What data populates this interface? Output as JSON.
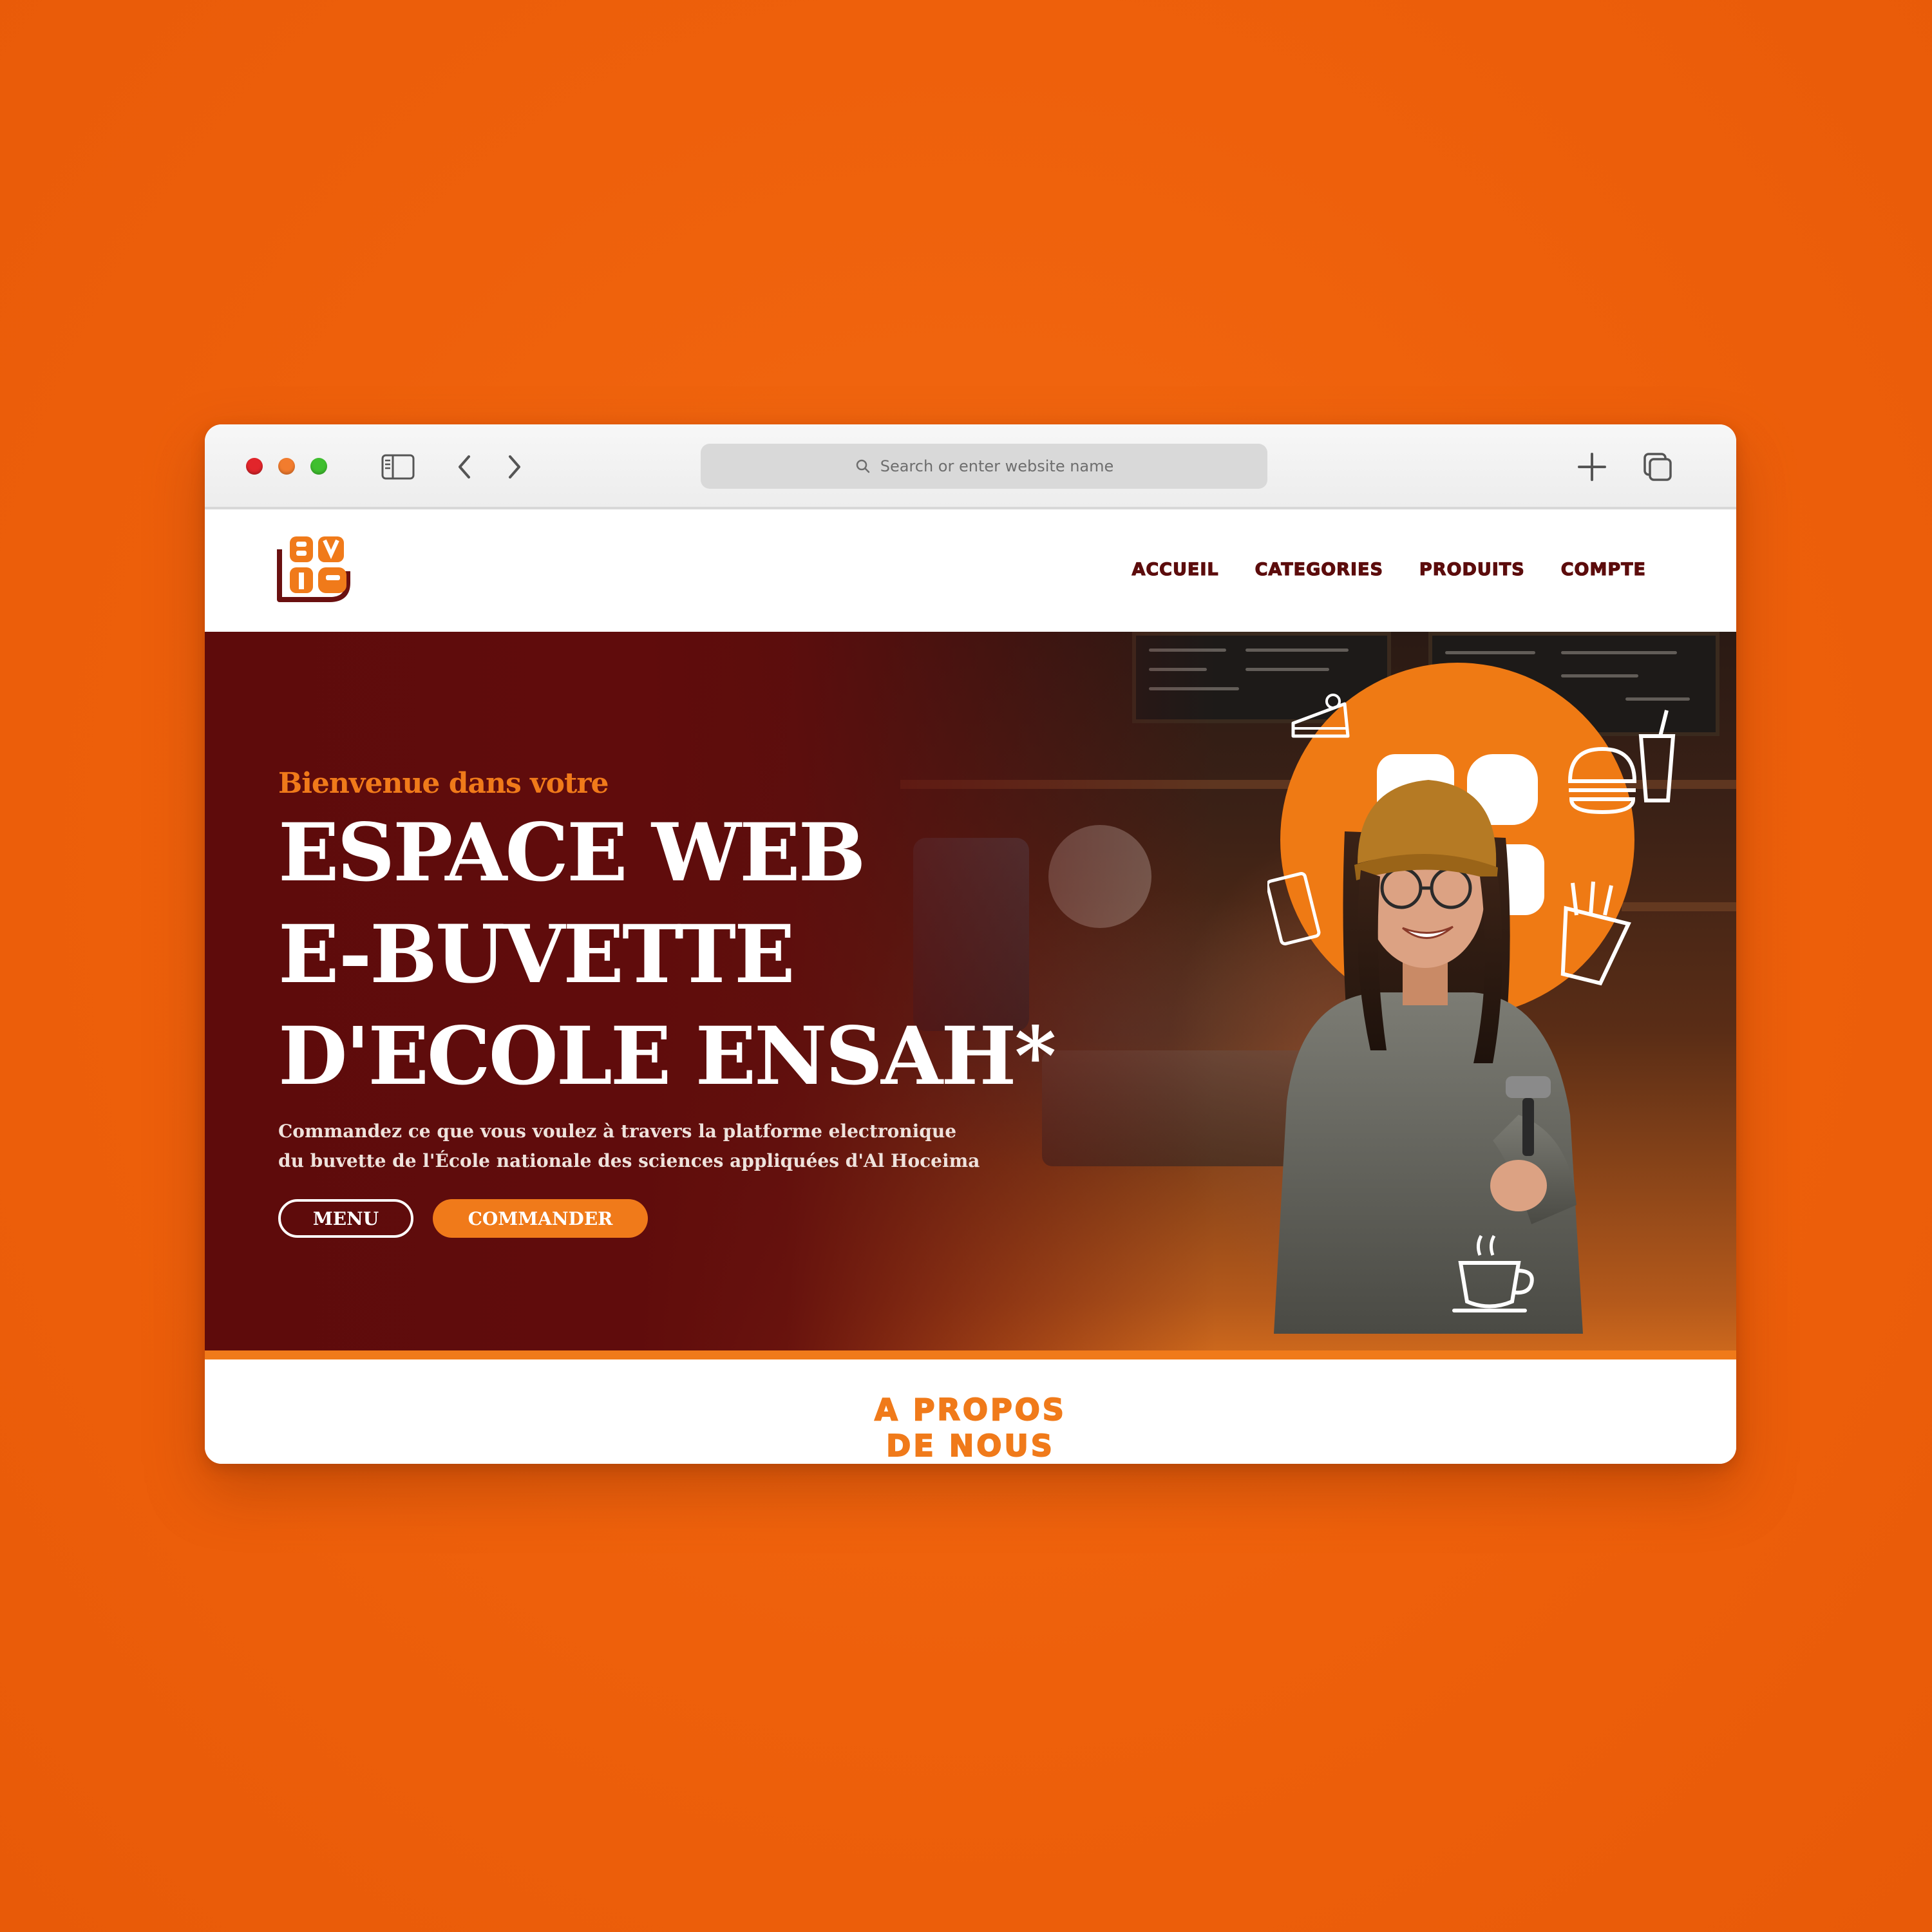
{
  "browser": {
    "address_placeholder": "Search or enter website name",
    "icons": [
      "sidebar-icon",
      "back-icon",
      "forward-icon",
      "search-icon",
      "new-tab-icon",
      "tabs-overview-icon"
    ]
  },
  "nav": {
    "logo_text": "BVTE",
    "links": [
      "ACCUEIL",
      "CATEGORIES",
      "PRODUITS",
      "COMPTE"
    ]
  },
  "hero": {
    "eyebrow": "Bienvenue dans votre",
    "headline": "ESPACE WEB\nE-BUVETTE\nD'ECOLE ENSAH*",
    "subtitle": "Commandez ce que vous voulez à travers la platforme electronique du buvette de l'École nationale des sciences appliquées d'Al Hoceima",
    "buttons": {
      "menu": "MENU",
      "order": "COMMANDER"
    }
  },
  "about": {
    "title": "A PROPOS\nDE NOUS"
  },
  "colors": {
    "background": "#ee600b",
    "accent": "#f07a1a",
    "hero_maroon": "#600c0c",
    "nav_text": "#5c0c0c"
  }
}
